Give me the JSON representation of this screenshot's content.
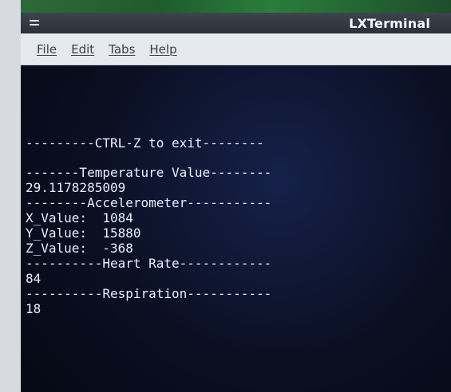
{
  "window": {
    "title": "LXTerminal"
  },
  "menubar": {
    "items": [
      "File",
      "Edit",
      "Tabs",
      "Help"
    ]
  },
  "terminal": {
    "lines": [
      "---------CTRL-Z to exit--------",
      "",
      "-------Temperature Value--------",
      "29.1178285009",
      "--------Accelerometer-----------",
      "X_Value:  1084",
      "Y_Value:  15880",
      "Z_Value:  -368",
      "----------Heart Rate------------",
      "84",
      "----------Respiration-----------",
      "18"
    ]
  },
  "colors": {
    "terminal_bg": "#0a0f22",
    "terminal_fg": "#e8f0ff",
    "titlebar_bg": "#2b3038",
    "menubar_bg": "#e6eaee"
  },
  "icons": {
    "app_menu": "hamburger-icon"
  }
}
